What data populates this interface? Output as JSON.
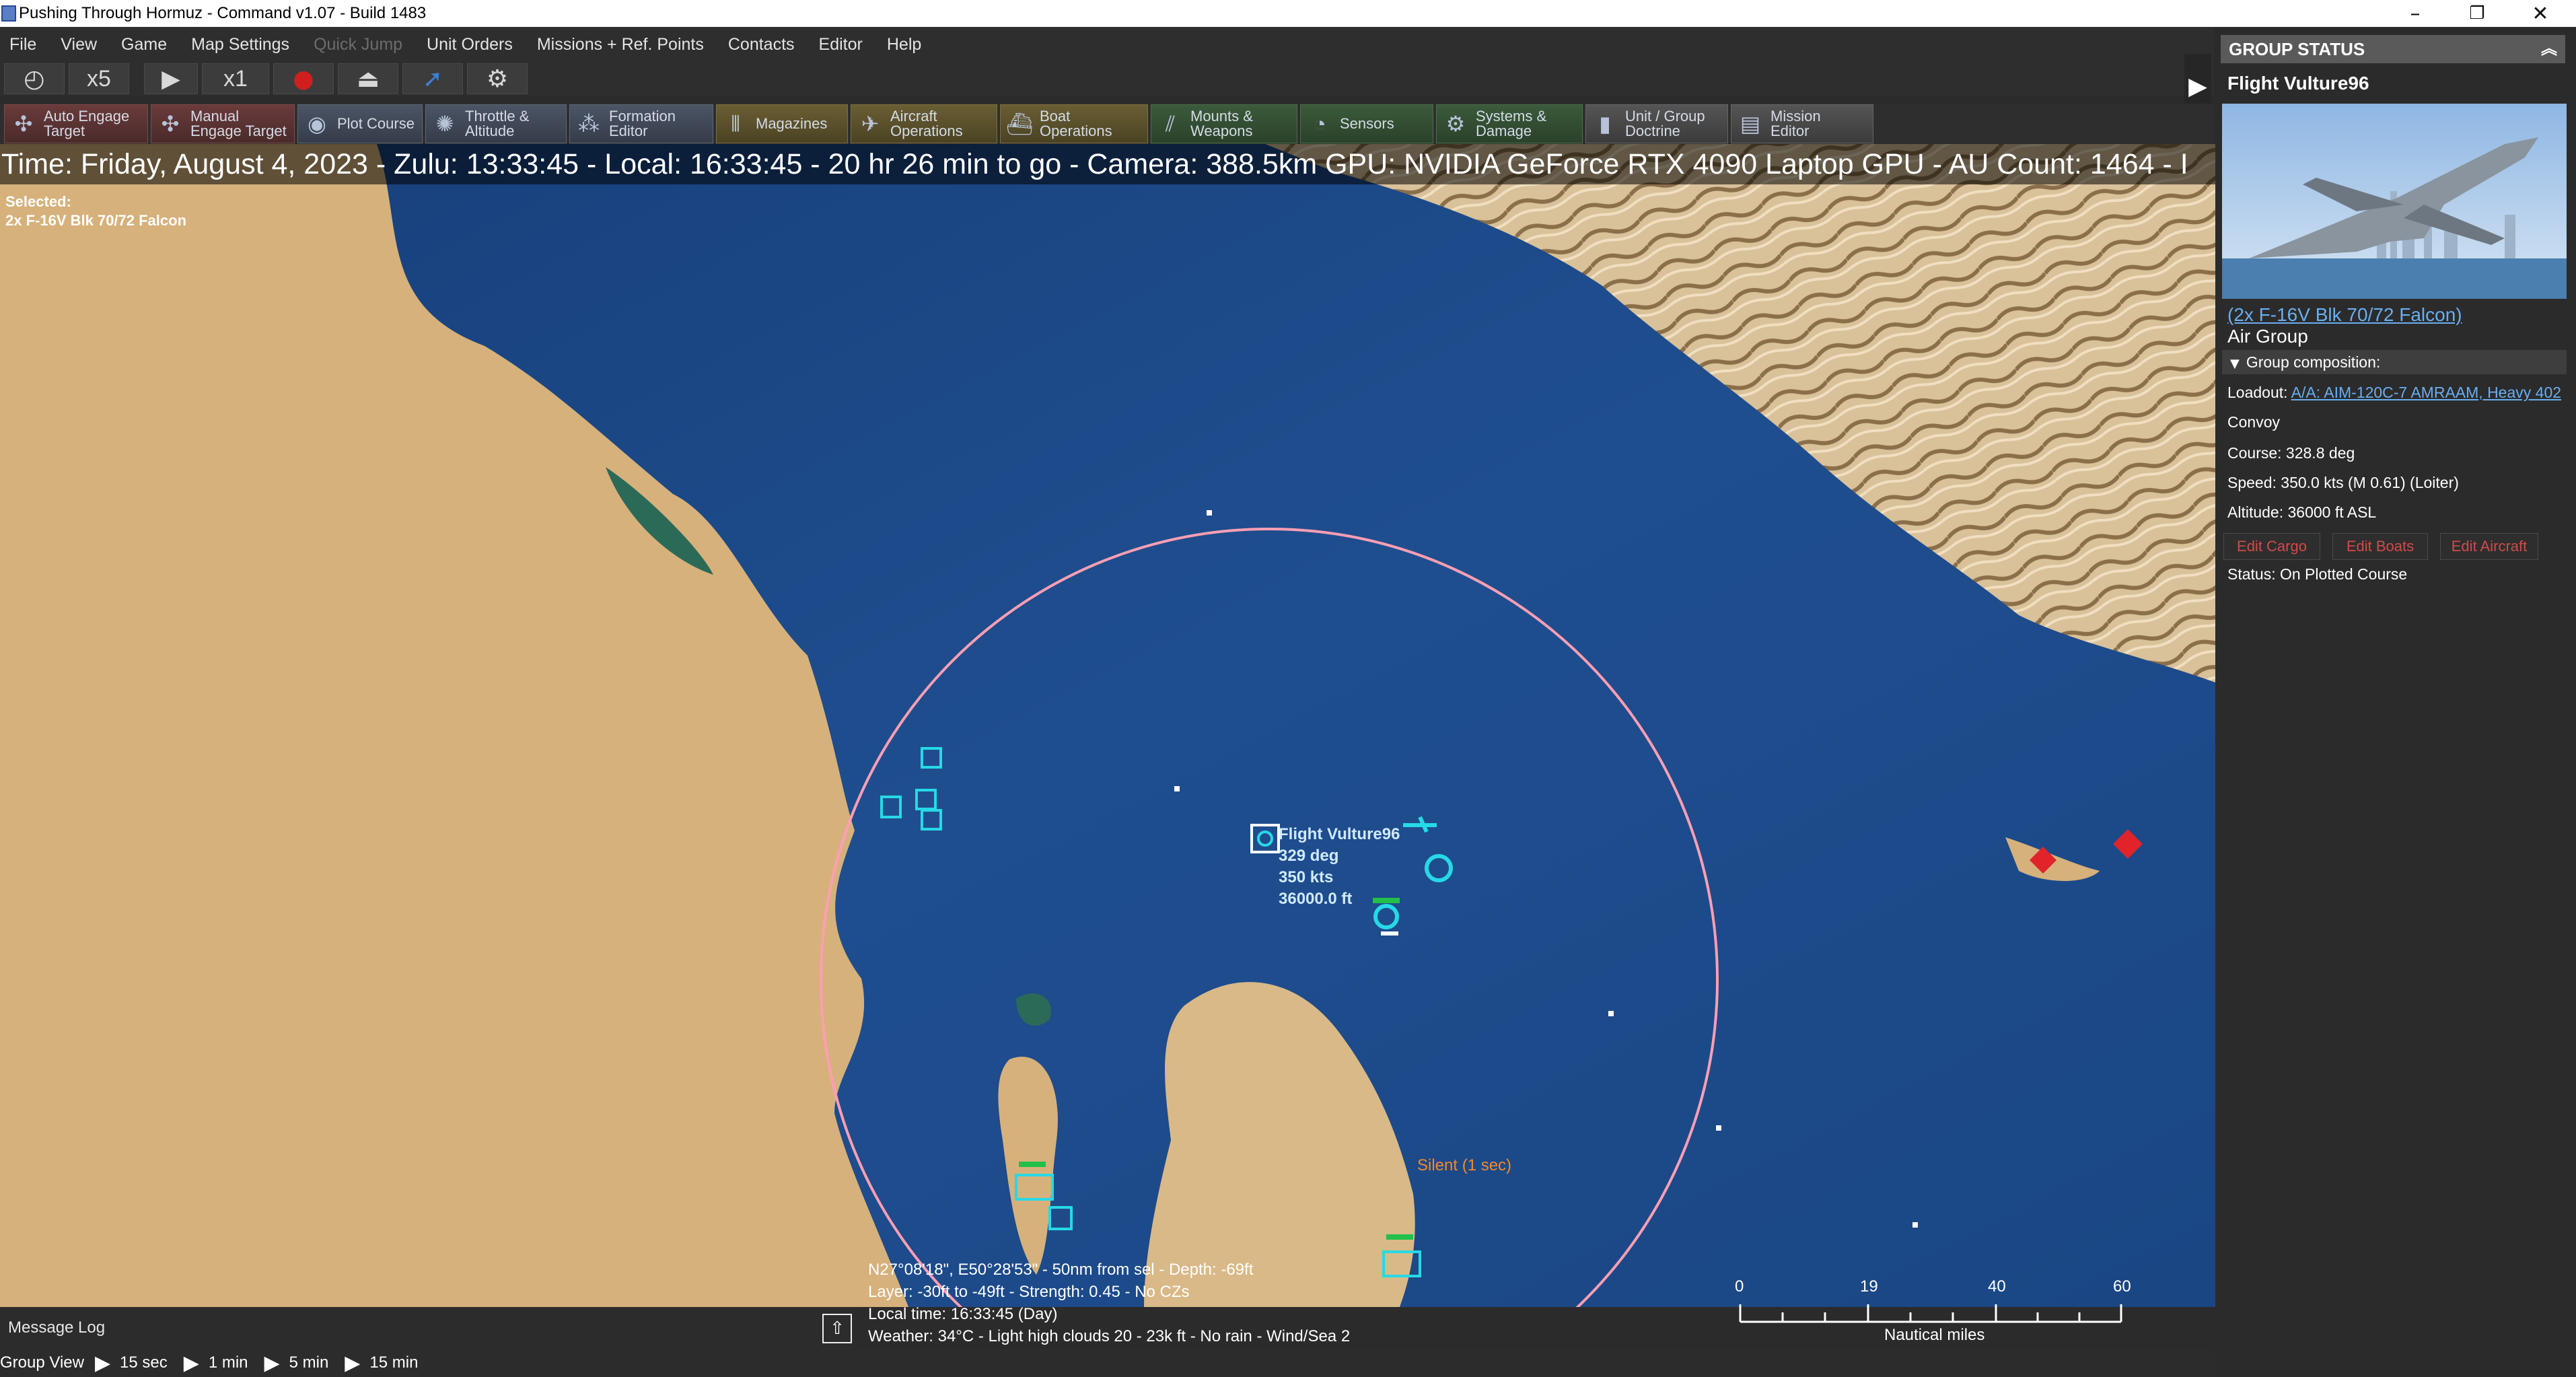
{
  "window": {
    "title": "Pushing Through Hormuz - Command v1.07 - Build 1483",
    "controls": [
      "–",
      "❐",
      "✕"
    ]
  },
  "menu": [
    {
      "label": "File",
      "enabled": true
    },
    {
      "label": "View",
      "enabled": true
    },
    {
      "label": "Game",
      "enabled": true
    },
    {
      "label": "Map Settings",
      "enabled": true
    },
    {
      "label": "Quick Jump",
      "enabled": false
    },
    {
      "label": "Unit Orders",
      "enabled": true
    },
    {
      "label": "Missions + Ref. Points",
      "enabled": true
    },
    {
      "label": "Contacts",
      "enabled": true
    },
    {
      "label": "Editor",
      "enabled": true
    },
    {
      "label": "Help",
      "enabled": true
    }
  ],
  "time_controls": {
    "compression_label": "x5",
    "speed_label": "x1"
  },
  "toolbar": [
    {
      "label": "Auto Engage Target",
      "line1": "Auto Engage",
      "line2": "Target",
      "style": "red",
      "icon": "crosshair-icon",
      "glyph": "✣"
    },
    {
      "label": "Manual Engage Target",
      "line1": "Manual",
      "line2": "Engage Target",
      "style": "red",
      "icon": "crosshair-manual-icon",
      "glyph": "✣"
    },
    {
      "label": "Plot Course",
      "line1": "Plot Course",
      "line2": "",
      "style": "blue",
      "icon": "course-icon",
      "glyph": "◉"
    },
    {
      "label": "Throttle & Altitude",
      "line1": "Throttle &",
      "line2": "Altitude",
      "style": "blue",
      "icon": "throttle-icon",
      "glyph": "✺"
    },
    {
      "label": "Formation Editor",
      "line1": "Formation",
      "line2": "Editor",
      "style": "blue",
      "icon": "formation-icon",
      "glyph": "⁂"
    },
    {
      "label": "Magazines",
      "line1": "Magazines",
      "line2": "",
      "style": "gold",
      "icon": "magazine-icon",
      "glyph": "⦀"
    },
    {
      "label": "Aircraft Operations",
      "line1": "Aircraft",
      "line2": "Operations",
      "style": "gold",
      "icon": "aircraft-icon",
      "glyph": "✈"
    },
    {
      "label": "Boat Operations",
      "line1": "Boat",
      "line2": "Operations",
      "style": "gold",
      "icon": "boat-icon",
      "glyph": "⛴"
    },
    {
      "label": "Mounts & Weapons",
      "line1": "Mounts &",
      "line2": "Weapons",
      "style": "green",
      "icon": "weapons-icon",
      "glyph": "⫽"
    },
    {
      "label": "Sensors",
      "line1": "Sensors",
      "line2": "",
      "style": "green",
      "icon": "sensor-icon",
      "glyph": "◔"
    },
    {
      "label": "Systems & Damage",
      "line1": "Systems &",
      "line2": "Damage",
      "style": "green",
      "icon": "systems-icon",
      "glyph": "⚙"
    },
    {
      "label": "Unit / Group Doctrine",
      "line1": "Unit / Group",
      "line2": "Doctrine",
      "style": "grey",
      "icon": "doctrine-icon",
      "glyph": "▮"
    },
    {
      "label": "Mission Editor",
      "line1": "Mission",
      "line2": "Editor",
      "style": "grey",
      "icon": "mission-icon",
      "glyph": "▤"
    }
  ],
  "map": {
    "status_line": "Time: Friday, August 4, 2023 - Zulu: 13:33:45 - Local: 16:33:45 - 20 hr 26 min to go - Camera: 388.5km GPU: NVIDIA GeForce RTX 4090 Laptop GPU - AU Count: 1464 - I",
    "selected_label": "Selected:",
    "selected_value": "2x F-16V Blk 70/72 Falcon",
    "unit_label": {
      "name": "Flight Vulture96",
      "course": "329 deg",
      "speed": "350 kts",
      "altitude": "36000.0 ft"
    },
    "contact_tag": "Silent (1 sec)",
    "cursor_info": [
      "N27°08'18\", E50°28'53\" - 50nm from sel - Depth: -69ft",
      "Layer: -30ft to -49ft - Strength: 0.45 - No CZs",
      "Local time: 16:33:45 (Day)",
      "Weather: 34°C - Light high clouds 20 - 23k ft - No rain - Wind/Sea 2"
    ],
    "scale": {
      "ticks": [
        "0",
        "19",
        "40",
        "60"
      ],
      "unit": "Nautical miles"
    },
    "colors": {
      "sea": "#1f4e8f",
      "land": "#d8b27e",
      "range_ring": "#ff9eb4",
      "friendly": "#26d9e6",
      "hostile": "#e0242a",
      "contact_tag": "#f28a29"
    }
  },
  "message_log": {
    "label": "Message Log"
  },
  "bottom_bar": {
    "group_view": "Group View",
    "steps": [
      "15 sec",
      "1 min",
      "5 min",
      "15 min"
    ]
  },
  "group_status": {
    "header": "GROUP STATUS",
    "group_name": "Flight Vulture96",
    "unit_link": "(2x F-16V Blk 70/72 Falcon)",
    "unit_type": "Air Group",
    "composition_label": "Group composition:",
    "loadout_label": "Loadout:",
    "loadout_value": "A/A: AIM-120C-7 AMRAAM, Heavy 402",
    "convoy": "Convoy",
    "course": "Course: 328.8 deg",
    "speed": "Speed: 350.0 kts (M 0.61) (Loiter)",
    "altitude": "Altitude: 36000 ft ASL",
    "buttons": [
      "Edit Cargo",
      "Edit Boats",
      "Edit Aircraft"
    ],
    "status": "Status: On Plotted Course"
  }
}
